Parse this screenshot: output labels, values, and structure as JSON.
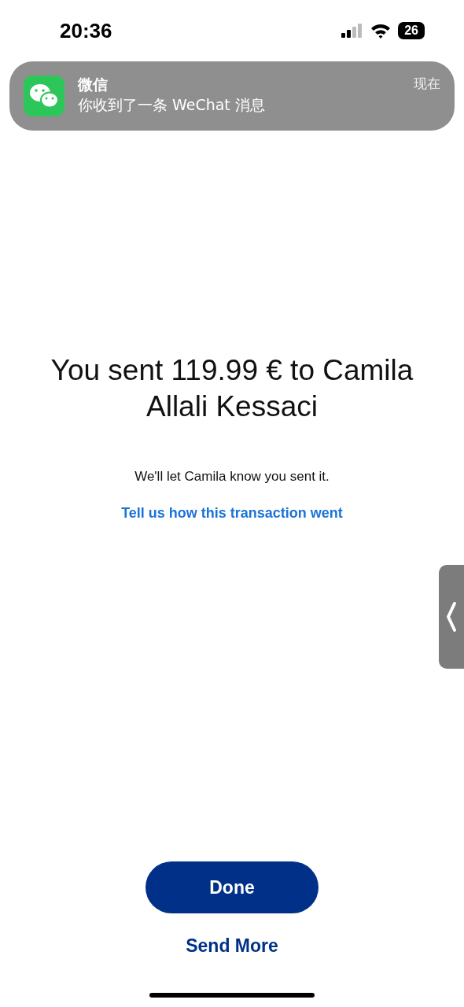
{
  "status_bar": {
    "time": "20:36",
    "battery": "26"
  },
  "notification": {
    "app": "微信",
    "message": "你收到了一条 WeChat 消息",
    "time": "现在"
  },
  "confirmation": {
    "title": "You sent 119.99 € to Camila Allali Kessaci",
    "subtitle": "We'll let Camila know you sent it.",
    "feedback_link": "Tell us how this transaction went"
  },
  "buttons": {
    "primary": "Done",
    "secondary": "Send More"
  }
}
